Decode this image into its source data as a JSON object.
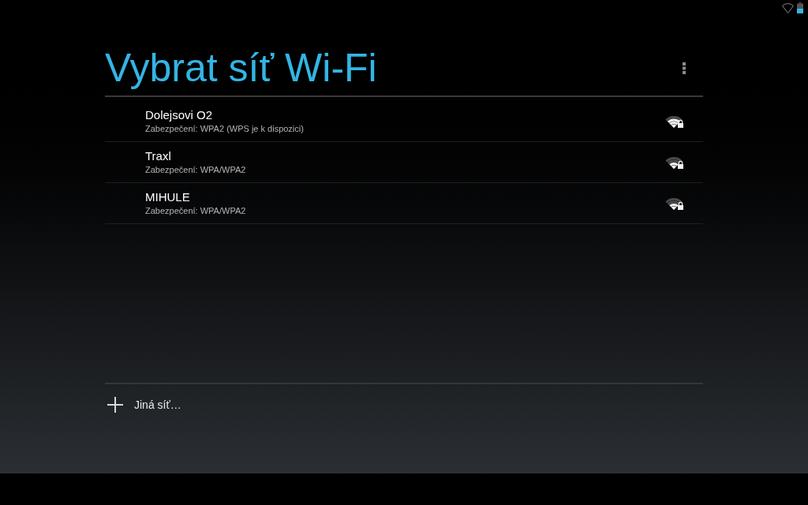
{
  "title": "Vybrat síť Wi-Fi",
  "networks": [
    {
      "name": "Dolejsovi O2",
      "security": "Zabezpečení: WPA2 (WPS je k dispozici)",
      "kind": "good",
      "locked": true
    },
    {
      "name": "Traxl",
      "security": "Zabezpečení: WPA/WPA2",
      "kind": "fair",
      "locked": true
    },
    {
      "name": "MIHULE",
      "security": "Zabezpečení: WPA/WPA2",
      "kind": "fair",
      "locked": true
    }
  ],
  "add_network": {
    "label": "Jiná síť…"
  }
}
